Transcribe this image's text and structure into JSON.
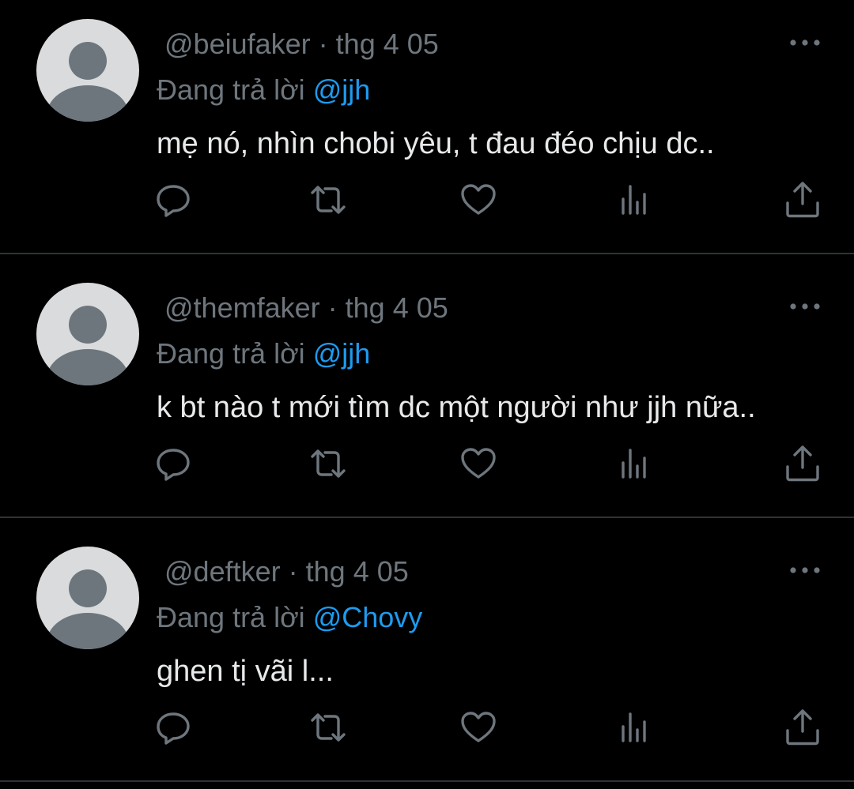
{
  "colors": {
    "background": "#000000",
    "secondary_text": "#6e767d",
    "primary_text": "#e7e9ea",
    "mention": "#1d9bf0",
    "divider": "#2f3336",
    "avatar_bg": "#d9dbdd",
    "avatar_figure": "#6e767d"
  },
  "tweets": [
    {
      "handle": "@beiufaker",
      "separator": "·",
      "date": "thg 4 05",
      "reply_prefix": "Đang trả lời",
      "reply_to": "@jjh",
      "text": "mẹ nó, nhìn chobi yêu, t đau đéo chịu dc..",
      "icons": [
        "more-icon",
        "reply-icon",
        "retweet-icon",
        "like-icon",
        "views-icon",
        "share-icon"
      ]
    },
    {
      "handle": "@themfaker",
      "separator": "·",
      "date": "thg 4 05",
      "reply_prefix": "Đang trả lời",
      "reply_to": "@jjh",
      "text": "k bt nào t mới tìm dc một người như jjh nữa..",
      "icons": [
        "more-icon",
        "reply-icon",
        "retweet-icon",
        "like-icon",
        "views-icon",
        "share-icon"
      ]
    },
    {
      "handle": "@deftker",
      "separator": "·",
      "date": "thg 4 05",
      "reply_prefix": "Đang trả lời",
      "reply_to": "@Chovy",
      "text": "ghen tị vãi l...",
      "icons": [
        "more-icon",
        "reply-icon",
        "retweet-icon",
        "like-icon",
        "views-icon",
        "share-icon"
      ]
    }
  ]
}
